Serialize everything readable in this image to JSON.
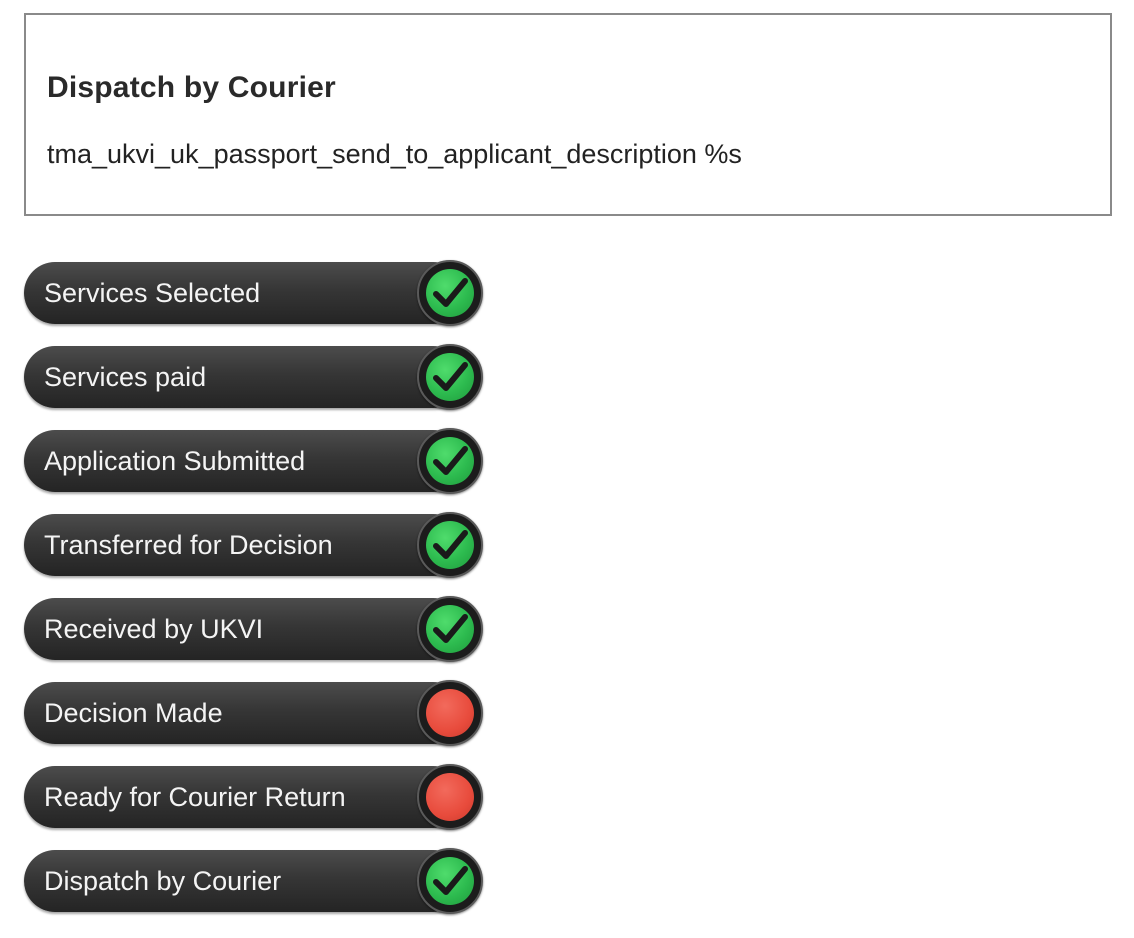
{
  "info": {
    "title": "Dispatch by Courier",
    "description": "tma_ukvi_uk_passport_send_to_applicant_description %s"
  },
  "colors": {
    "complete": "#2dbb4f",
    "pending": "#e84b3c"
  },
  "steps": [
    {
      "label": "Services Selected",
      "status": "complete",
      "icon": "check-icon"
    },
    {
      "label": "Services paid",
      "status": "complete",
      "icon": "check-icon"
    },
    {
      "label": "Application Submitted",
      "status": "complete",
      "icon": "check-icon"
    },
    {
      "label": "Transferred for Decision",
      "status": "complete",
      "icon": "check-icon"
    },
    {
      "label": "Received by UKVI",
      "status": "complete",
      "icon": "check-icon"
    },
    {
      "label": "Decision Made",
      "status": "pending",
      "icon": "red-dot-icon"
    },
    {
      "label": "Ready for Courier Return",
      "status": "pending",
      "icon": "red-dot-icon"
    },
    {
      "label": "Dispatch by Courier",
      "status": "complete",
      "icon": "check-icon"
    }
  ]
}
